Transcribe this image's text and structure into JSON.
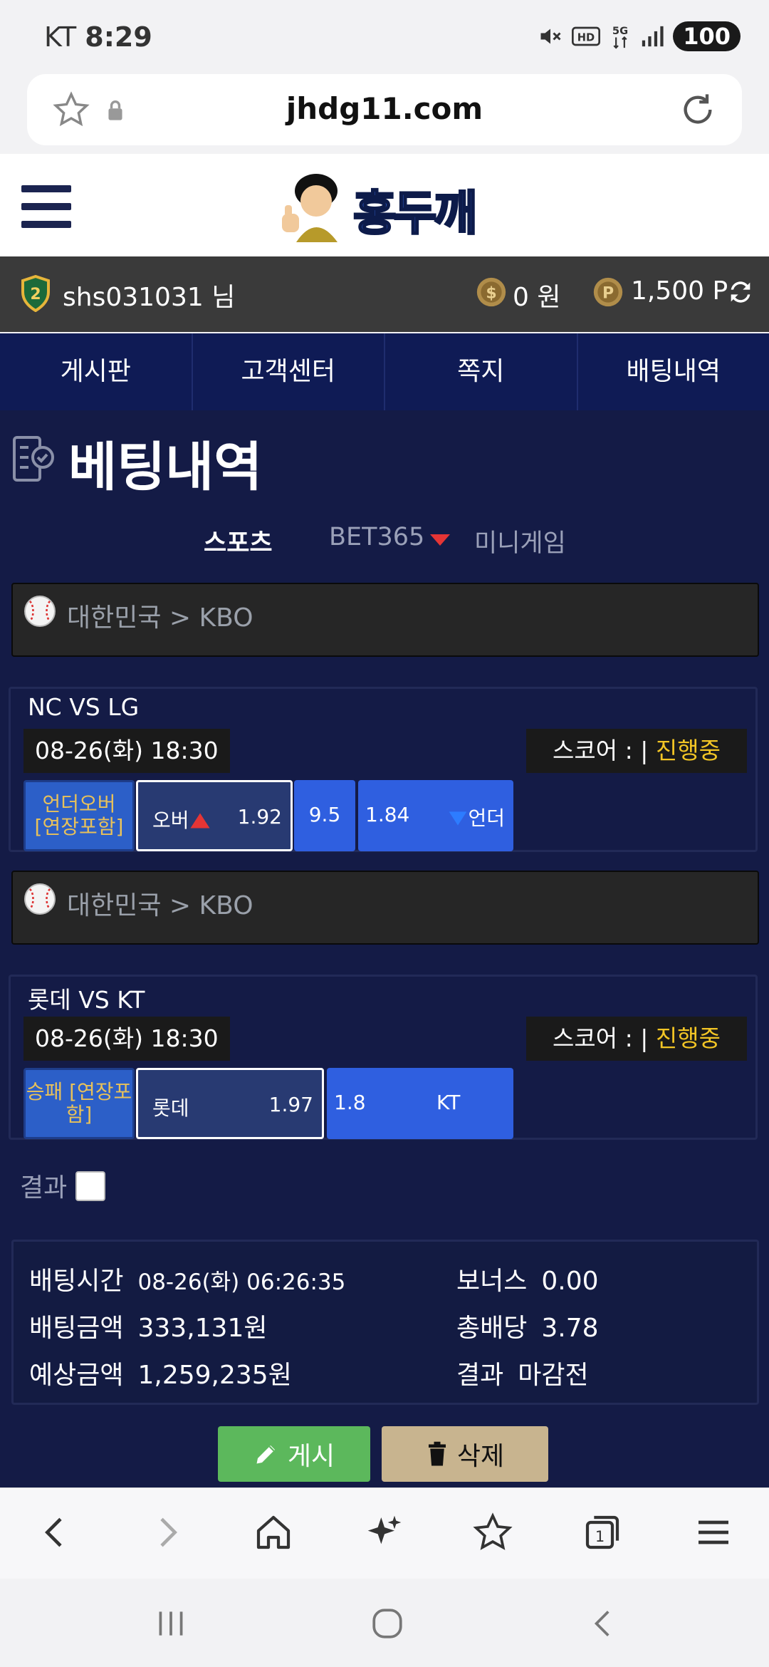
{
  "status_bar": {
    "carrier": "KT",
    "time": "8:29",
    "battery": "100"
  },
  "browser": {
    "url": "jhdg11.com"
  },
  "site": {
    "logo_text": "홍두깨"
  },
  "user": {
    "name": "shs031031 님",
    "money": "0 원",
    "points": "1,500 P"
  },
  "nav": {
    "items": [
      "게시판",
      "고객센터",
      "쪽지",
      "배팅내역"
    ]
  },
  "page": {
    "title": "베팅내역",
    "subtabs": [
      "스포츠",
      "BET365",
      "미니게임"
    ]
  },
  "bets": [
    {
      "league": "대한민국 > KBO",
      "match": "NC VS LG",
      "time": "08-26(화) 18:30",
      "score_label": "스코어 : |",
      "status": "진행중",
      "bet_type_line1": "언더오버",
      "bet_type_line2": "[연장포함]",
      "home_label": "오버",
      "home_odds": "1.92",
      "middle": "9.5",
      "away_odds": "1.84",
      "away_label": "언더"
    },
    {
      "league": "대한민국 > KBO",
      "match": "롯데 VS KT",
      "time": "08-26(화) 18:30",
      "score_label": "스코어 : |",
      "status": "진행중",
      "bet_type": "승패 [연장포함]",
      "home_label": "롯데",
      "home_odds": "1.97",
      "away_odds": "1.8",
      "away_label": "KT"
    }
  ],
  "result": {
    "label": "결과"
  },
  "summary": {
    "bet_time_label": "배팅시간",
    "bet_time": "08-26(화) 06:26:35",
    "bet_amount_label": "배팅금액",
    "bet_amount": "333,131원",
    "expected_label": "예상금액",
    "expected": "1,259,235원",
    "bonus_label": "보너스",
    "bonus": "0.00",
    "total_odds_label": "총배당",
    "total_odds": "3.78",
    "result_label": "결과",
    "result": "마감전"
  },
  "buttons": {
    "post": "게시",
    "delete": "삭제"
  },
  "colors": {
    "nav_bg": "#0f1b55",
    "content_bg": "#141b46",
    "status_yellow": "#f2c525",
    "blue": "#2f5fe0"
  }
}
